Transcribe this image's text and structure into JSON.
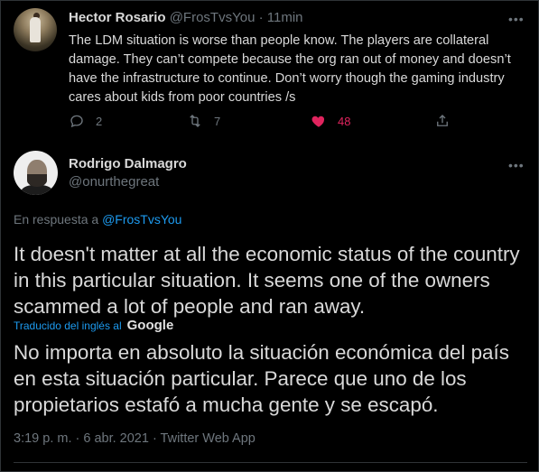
{
  "tweet1": {
    "display_name": "Hector Rosario",
    "handle": "@FrosTvsYou",
    "separator": "·",
    "time": "11min",
    "text": "The LDM situation is worse than people know. The players are collateral damage. They can’t compete because the org ran out of money and doesn’t have the infrastructure to continue. Don’t worry though the gaming industry cares about kids from poor countries /s",
    "replies": "2",
    "retweets": "7",
    "likes": "48",
    "liked": true,
    "more_icon": "more-dots-icon"
  },
  "tweet2": {
    "display_name": "Rodrigo Dalmagro",
    "handle": "@onurthegreat",
    "reply_prefix": "En respuesta a",
    "reply_to": "@FrosTvsYou",
    "text": "It doesn't matter at all the economic status of the country in this particular situation. It seems one of the owners scammed a lot of people and ran away.",
    "translated_label": "Traducido del inglés al",
    "translator": "Google",
    "translation": "No importa en absoluto la situación económica del país en esta situación particular. Parece que uno de los propietarios estafó a mucha gente y se escapó.",
    "timestamp": "3:19 p. m. · 6 abr. 2021 · Twitter Web App"
  },
  "colors": {
    "background": "#000000",
    "text": "#d9d9d9",
    "muted": "#6e767d",
    "link": "#1d9bf0",
    "like": "#e0245e",
    "border": "#2f3336"
  }
}
